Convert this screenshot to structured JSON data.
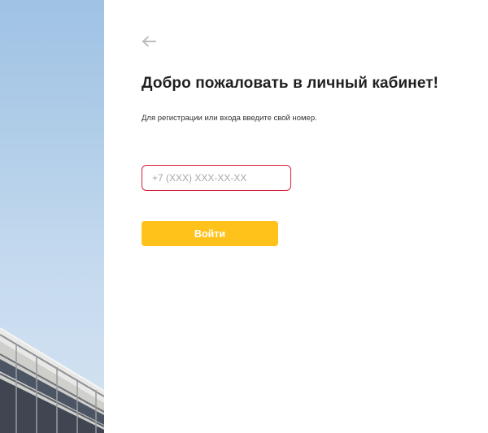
{
  "photo": {
    "icon": "building-photo"
  },
  "header": {
    "back_icon": "arrow-left-icon"
  },
  "main": {
    "title": "Добро пожаловать в личный кабинет!",
    "subtitle": "Для регистрации или входа введите свой номер.",
    "phone_input": {
      "value": "",
      "placeholder": "+7 (XXX) XXX-XX-XX"
    },
    "login_button_label": "Войти"
  },
  "colors": {
    "accent": "#FFC21A",
    "input_border_error": "#D9213A",
    "title_text": "#1F1F1F",
    "back_arrow": "#BDBDBD"
  }
}
